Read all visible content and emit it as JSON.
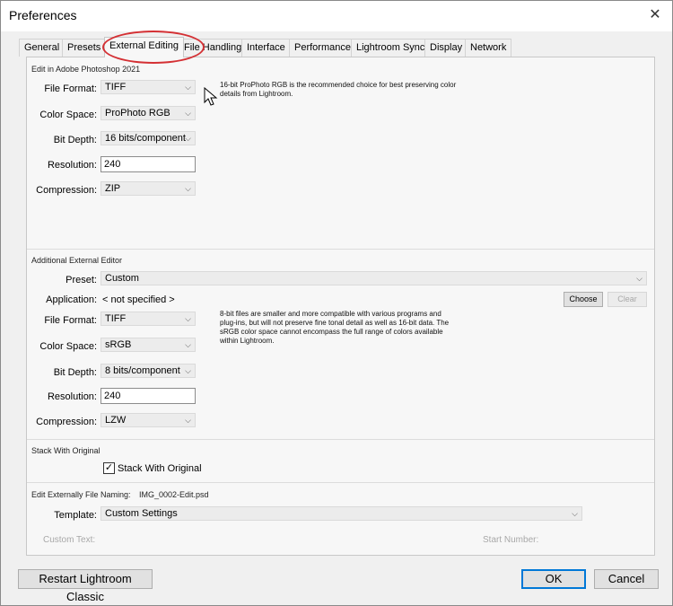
{
  "window": {
    "title": "Preferences"
  },
  "tabs": [
    {
      "label": "General"
    },
    {
      "label": "Presets"
    },
    {
      "label": "External Editing"
    },
    {
      "label": "File Handling"
    },
    {
      "label": "Interface"
    },
    {
      "label": "Performance"
    },
    {
      "label": "Lightroom Sync"
    },
    {
      "label": "Display"
    },
    {
      "label": "Network"
    }
  ],
  "photoshop": {
    "section_title": "Edit in Adobe Photoshop 2021",
    "file_format_label": "File Format:",
    "file_format": "TIFF",
    "color_space_label": "Color Space:",
    "color_space": "ProPhoto RGB",
    "bit_depth_label": "Bit Depth:",
    "bit_depth": "16 bits/component",
    "resolution_label": "Resolution:",
    "resolution": "240",
    "compression_label": "Compression:",
    "compression": "ZIP",
    "note_line1": "16-bit ProPhoto RGB is the recommended choice for best preserving color",
    "note_line2": "details from Lightroom."
  },
  "additional": {
    "section_title": "Additional External Editor",
    "preset_label": "Preset:",
    "preset": "Custom",
    "application_label": "Application:",
    "application": "< not specified >",
    "choose_label": "Choose",
    "clear_label": "Clear",
    "file_format_label": "File Format:",
    "file_format": "TIFF",
    "color_space_label": "Color Space:",
    "color_space": "sRGB",
    "bit_depth_label": "Bit Depth:",
    "bit_depth": "8 bits/component",
    "resolution_label": "Resolution:",
    "resolution": "240",
    "compression_label": "Compression:",
    "compression": "LZW",
    "note_line1": "8-bit files are smaller and more compatible with various programs and",
    "note_line2": "plug-ins, but will not preserve fine tonal detail as well as 16-bit data. The",
    "note_line3": "sRGB color space cannot encompass the full range of colors available",
    "note_line4": "within Lightroom."
  },
  "stack": {
    "section_title": "Stack With Original",
    "checkbox_label": "Stack With Original",
    "checked": true
  },
  "naming": {
    "section_title": "Edit Externally File Naming:",
    "example": "IMG_0002-Edit.psd",
    "template_label": "Template:",
    "template": "Custom Settings",
    "custom_text_label": "Custom Text:",
    "start_number_label": "Start Number:"
  },
  "footer": {
    "restart_label": "Restart Lightroom Classic",
    "ok_label": "OK",
    "cancel_label": "Cancel"
  },
  "colors": {
    "highlight_circle": "#d43034",
    "default_button_border": "#0078d7"
  }
}
